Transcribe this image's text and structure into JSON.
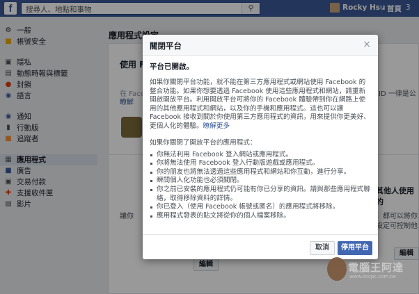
{
  "topbar": {
    "logo": "f",
    "search_placeholder": "搜尋人、地點和事物",
    "search_icon": "search-icon",
    "user_name": "Rocky Hsu",
    "home_label": "首頁",
    "home_count": "3"
  },
  "sidebar": {
    "groups": [
      [
        {
          "label": "一般",
          "icon": "gear-icon"
        },
        {
          "label": "帳號安全",
          "icon": "shield-icon"
        }
      ],
      [
        {
          "label": "隱私",
          "icon": "lock-icon"
        },
        {
          "label": "動態時報與標籤",
          "icon": "timeline-icon"
        },
        {
          "label": "封鎖",
          "icon": "block-icon"
        },
        {
          "label": "語言",
          "icon": "globe-icon"
        }
      ],
      [
        {
          "label": "通知",
          "icon": "globe-icon"
        },
        {
          "label": "行動版",
          "icon": "mobile-icon"
        },
        {
          "label": "追蹤者",
          "icon": "rss-icon"
        }
      ],
      [
        {
          "label": "應用程式",
          "icon": "apps-icon",
          "active": true
        },
        {
          "label": "廣告",
          "icon": "ads-icon"
        },
        {
          "label": "交易付款",
          "icon": "payment-icon"
        },
        {
          "label": "支援收件匣",
          "icon": "support-icon"
        },
        {
          "label": "影片",
          "icon": "video-icon"
        }
      ]
    ]
  },
  "main": {
    "title": "應用程式設定",
    "use_fb": "使用 Fa",
    "bg_text1": "在 Facebo",
    "bg_link1": "瞭解",
    "bg_text2": "讓你",
    "bg_right1": "ID 一律是公",
    "bg_right2": "其他人使用的",
    "bg_right3": "，都可以將你",
    "bg_right4": "設定可控制他",
    "edit_label": "編輯"
  },
  "dialog": {
    "title": "關閉平台",
    "close": "×",
    "heading": "平台已開啟。",
    "paragraph": "如果你關閉平台功能，就不能在第三方應用程式或網站使用 Facebook 的整合功能。如果你想要透過 Facebook 使用這些應用程式和網站，請重新開啟開放平台。利用開放平台可將你的 Facebook 體驗帶到你在網路上使用的其他應用程式和網站，以及你的手機和應用程式。這也可以讓 Facebook 接收到關於你使用第三方應用程式的資訊，用來提供你更美好、更個人化的體驗。",
    "learn_more": "瞭解更多",
    "sub": "如果你關閉了開放平台的應用程式：",
    "items": [
      "你無法利用 Facebook 登入網站或應用程式。",
      "你將無法使用 Facebook 登入行動版遊戲或應用程式。",
      "你的朋友也將無法透過這些應用程式和網站和你互動，進行分享。",
      "瞬間個人化功能也必須關閉。",
      "你之前已安裝的應用程式仍可能有你已分享的資訊。請與那些應用程式聯絡，取得移除資料的詳情。",
      "你已登入（使用 Facebook 帳號或匿名）的應用程式將移除。",
      "應用程式發表的貼文將從你的個人檔案移除。"
    ],
    "cancel_label": "取消",
    "disable_label": "停用平台"
  },
  "watermark": {
    "text": "電腦王阿達",
    "url": "www.kocpc.com.tw"
  },
  "colors": {
    "brand": "#3b5998",
    "primary_button": "#4267b2",
    "link": "#365899"
  }
}
